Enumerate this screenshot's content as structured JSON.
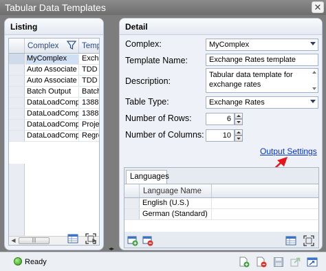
{
  "window": {
    "title": "Tabular Data Templates",
    "close_label": "✕"
  },
  "listing": {
    "title": "Listing",
    "columns": [
      "Complex",
      "Temp"
    ],
    "rows": [
      [
        "MyComplex",
        "Exch"
      ],
      [
        "Auto Associate",
        "TDD"
      ],
      [
        "Auto Associate",
        "TDD"
      ],
      [
        "Batch Output",
        "Batch"
      ],
      [
        "DataLoadComp",
        "1388"
      ],
      [
        "DataLoadComp",
        "1388"
      ],
      [
        "DataLoadComp",
        "Proje"
      ],
      [
        "DataLoadComp",
        "Regre"
      ]
    ],
    "scroll_thumb_label": "|||"
  },
  "detail": {
    "title": "Detail",
    "complex_label": "Complex:",
    "complex_value": "MyComplex",
    "template_name_label": "Template Name:",
    "template_name_value": "Exchange Rates template",
    "description_label": "Description:",
    "description_value": "Tabular data template for exchange rates",
    "table_type_label": "Table Type:",
    "table_type_value": "Exchange Rates",
    "rows_label": "Number of Rows:",
    "rows_value": "6",
    "columns_label": "Number of Columns:",
    "columns_value": "10",
    "output_settings_link": "Output Settings"
  },
  "languages": {
    "tab_label": "Languages",
    "column": "Language Name",
    "rows": [
      "English (U.S.)",
      "German (Standard)"
    ]
  },
  "status": {
    "text": "Ready"
  },
  "splitter": {
    "label": "◂▸"
  },
  "colors": {
    "accent_link": "#0033cc",
    "arrow": "#e8141a",
    "status_ok": "#2f9b11"
  }
}
